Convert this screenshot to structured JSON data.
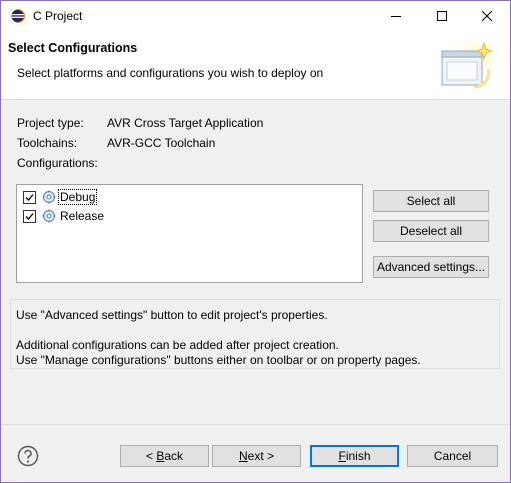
{
  "window": {
    "title": "C Project",
    "icon": "eclipse-icon",
    "controls": {
      "minimize": "minimize-icon",
      "maximize": "maximize-icon",
      "close": "close-icon"
    },
    "accent_border_color": "#8a72b8"
  },
  "header": {
    "title": "Select Configurations",
    "subtitle": "Select platforms and configurations you wish to deploy on",
    "icon": "wizard-banner-icon"
  },
  "info": {
    "project_type_label": "Project type:",
    "project_type_value": "AVR Cross Target Application",
    "toolchains_label": "Toolchains:",
    "toolchains_value": "AVR-GCC Toolchain",
    "configurations_label": "Configurations:"
  },
  "configurations": [
    {
      "label": "Debug",
      "checked": true,
      "icon": "configuration-icon"
    },
    {
      "label": "Release",
      "checked": true,
      "icon": "configuration-icon"
    }
  ],
  "side_buttons": {
    "select_all": "Select all",
    "deselect_all": "Deselect all",
    "advanced_settings": "Advanced settings..."
  },
  "messages": {
    "line1": "Use \"Advanced settings\" button to edit project's properties.",
    "line2": "Additional configurations can be added after project creation.",
    "line3": "Use \"Manage configurations\" buttons either on toolbar or on property pages."
  },
  "footer": {
    "help_icon": "help-icon",
    "back_prefix": "< ",
    "back_mnemonic": "B",
    "back_rest": "ack",
    "next_mnemonic": "N",
    "next_rest": "ext >",
    "finish_mnemonic": "F",
    "finish_rest": "inish",
    "cancel": "Cancel",
    "default_button_color": "#0078d7"
  }
}
